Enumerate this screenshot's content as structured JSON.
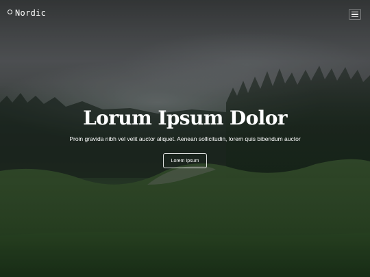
{
  "navbar": {
    "brand": "Nordic",
    "brand_icon": "circle-logo-icon",
    "menu_icon": "hamburger-menu-icon"
  },
  "hero": {
    "title": "Lorum Ipsum Dolor",
    "subtitle": "Proin gravida nibh vel velit auctor aliquet. Aenean sollicitudin, lorem quis bibendum auctor",
    "cta_label": "Lorem Ipsum"
  },
  "colors": {
    "text": "#ffffff",
    "sky_fog": "#5d6063",
    "forest": "#2a3d2b",
    "meadow": "#2c4a2a"
  }
}
